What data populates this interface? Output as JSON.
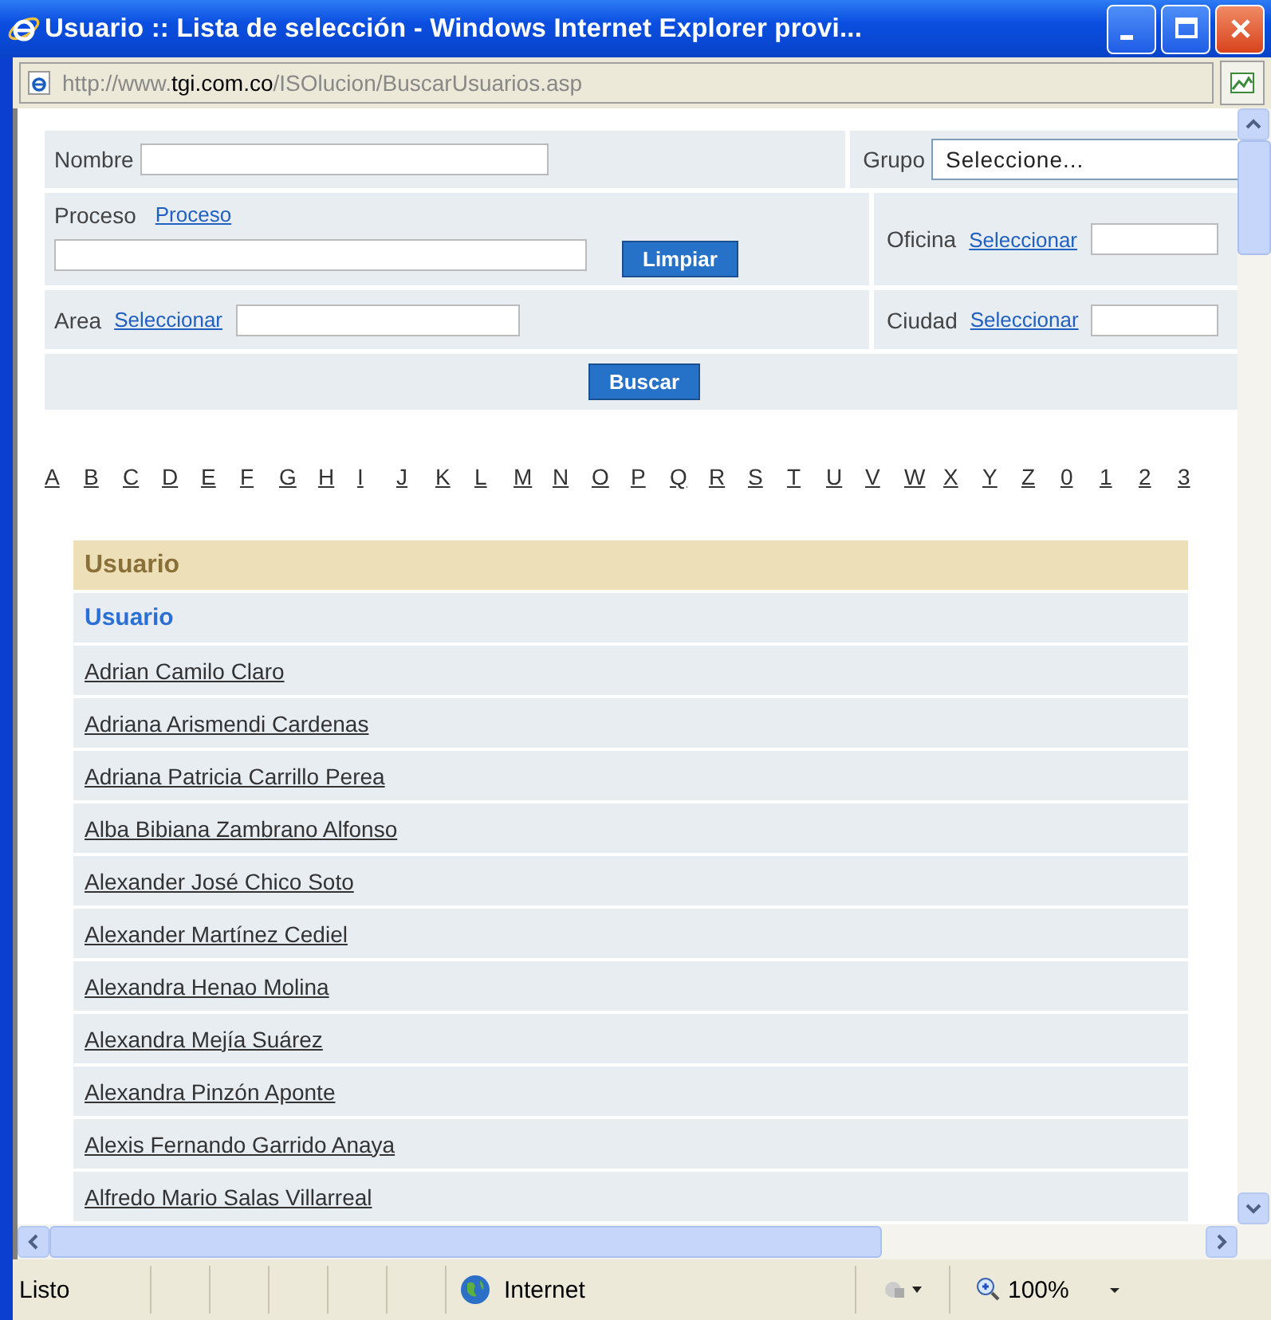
{
  "window": {
    "title": "Usuario :: Lista de selección - Windows Internet Explorer provi..."
  },
  "address_bar": {
    "url_prefix": "http://www.",
    "url_domain": "tgi.com.co",
    "url_path": "/ISOlucion/BuscarUsuarios.asp"
  },
  "form": {
    "nombre": {
      "label": "Nombre"
    },
    "grupo": {
      "label": "Grupo",
      "value": "Seleccione..."
    },
    "proceso": {
      "label": "Proceso",
      "link": "Proceso"
    },
    "limpiar_button": "Limpiar",
    "oficina": {
      "label": "Oficina",
      "link": "Seleccionar"
    },
    "area": {
      "label": "Area",
      "link": "Seleccionar"
    },
    "ciudad": {
      "label": "Ciudad",
      "link": "Seleccionar"
    },
    "buscar_button": "Buscar"
  },
  "alphabet": [
    "A",
    "B",
    "C",
    "D",
    "E",
    "F",
    "G",
    "H",
    "I",
    "J",
    "K",
    "L",
    "M",
    "N",
    "O",
    "P",
    "Q",
    "R",
    "S",
    "T",
    "U",
    "V",
    "W",
    "X",
    "Y",
    "Z",
    "0",
    "1",
    "2",
    "3"
  ],
  "table": {
    "header": "Usuario",
    "subheader": "Usuario",
    "rows": [
      "Adrian Camilo Claro",
      "Adriana Arismendi Cardenas",
      "Adriana Patricia Carrillo Perea",
      "Alba Bibiana Zambrano Alfonso",
      "Alexander José Chico Soto",
      "Alexander Martínez Cediel",
      "Alexandra Henao Molina",
      "Alexandra Mejía Suárez",
      "Alexandra Pinzón Aponte",
      "Alexis Fernando Garrido Anaya",
      "Alfredo Mario Salas Villarreal"
    ]
  },
  "status_bar": {
    "text": "Listo",
    "zone": "Internet",
    "zoom": "100%"
  }
}
